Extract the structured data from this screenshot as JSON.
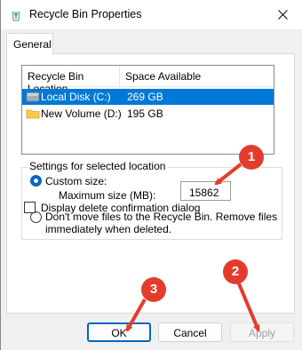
{
  "window": {
    "title": "Recycle Bin Properties",
    "icon": "recycle-bin-icon"
  },
  "tabs": [
    {
      "label": "General",
      "active": true
    }
  ],
  "list": {
    "columns": [
      "Recycle Bin Location",
      "Space Available"
    ],
    "rows": [
      {
        "name": "Local Disk (C:)",
        "space": "269 GB",
        "icon": "local-disk-icon",
        "selected": true
      },
      {
        "name": "New Volume (D:)",
        "space": "195 GB",
        "icon": "folder-drive-icon",
        "selected": false
      }
    ]
  },
  "settings": {
    "group_label": "Settings for selected location",
    "custom_size_label": "Custom size:",
    "max_size_label": "Maximum size (MB):",
    "max_size_value": "15862",
    "dont_move_line1": "Don't move files to the Recycle Bin. Remove files",
    "dont_move_line2": "immediately when deleted.",
    "custom_size_selected": true
  },
  "confirm_checkbox": {
    "label": "Display delete confirmation dialog",
    "checked": false
  },
  "buttons": {
    "ok": "OK",
    "cancel": "Cancel",
    "apply": "Apply"
  },
  "annotations": {
    "badge1": "1",
    "badge2": "2",
    "badge3": "3",
    "color": "#e43c2c"
  },
  "colors": {
    "selection": "#0078d7",
    "accent": "#0067c0"
  }
}
